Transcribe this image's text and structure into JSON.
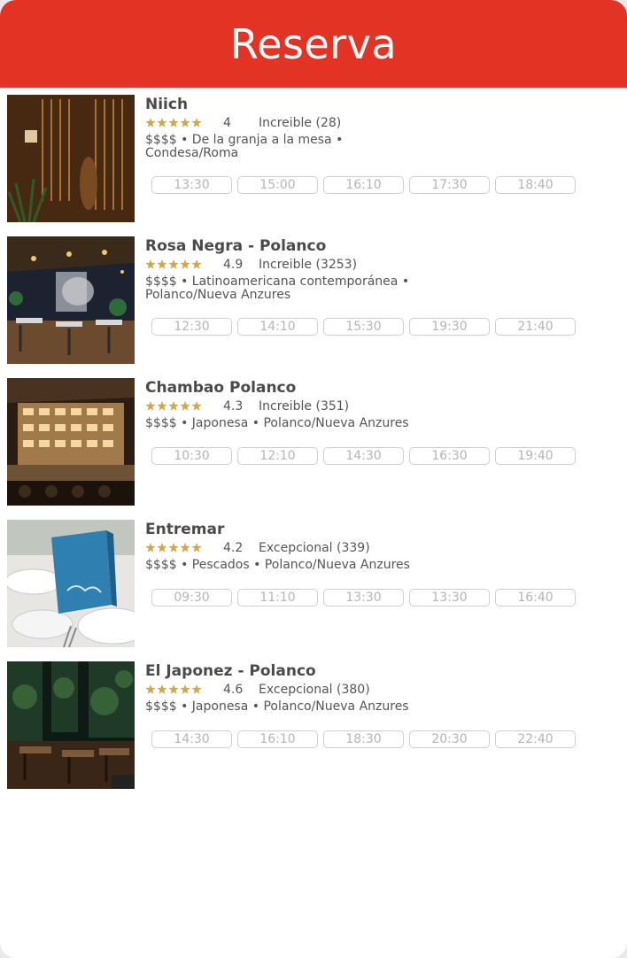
{
  "header": {
    "title": "Reserva"
  },
  "colors": {
    "brand": "#e23324",
    "star": "#d3a843"
  },
  "icons": {
    "rating": "star-icon"
  },
  "restaurants": [
    {
      "name": "Niich",
      "rating": "4",
      "review": "Increible (28)",
      "desc_line1": "$$$$ • De la granja a la mesa •",
      "desc_line2": "Condesa/Roma",
      "slots": [
        "13:30",
        "15:00",
        "16:10",
        "17:30",
        "18:40"
      ]
    },
    {
      "name": "Rosa Negra - Polanco",
      "rating": "4.9",
      "review": "Increible (3253)",
      "desc_line1": "$$$$ • Latinoamericana contemporánea •",
      "desc_line2": "Polanco/Nueva Anzures",
      "slots": [
        "12:30",
        "14:10",
        "15:30",
        "19:30",
        "21:40"
      ]
    },
    {
      "name": "Chambao Polanco",
      "rating": "4.3",
      "review": "Increible (351)",
      "desc_line1": "$$$$ • Japonesa • Polanco/Nueva Anzures",
      "slots": [
        "10:30",
        "12:10",
        "14:30",
        "16:30",
        "19:40"
      ]
    },
    {
      "name": "Entremar",
      "rating": "4.2",
      "review": "Excepcional (339)",
      "desc_line1": "$$$$ • Pescados • Polanco/Nueva Anzures",
      "slots": [
        "09:30",
        "11:10",
        "13:30",
        "13:30",
        "16:40"
      ]
    },
    {
      "name": "El Japonez - Polanco",
      "rating": "4.6",
      "review": "Excepcional (380)",
      "desc_line1": "$$$$ • Japonesa • Polanco/Nueva Anzures",
      "slots": [
        "14:30",
        "16:10",
        "18:30",
        "20:30",
        "22:40"
      ]
    }
  ]
}
